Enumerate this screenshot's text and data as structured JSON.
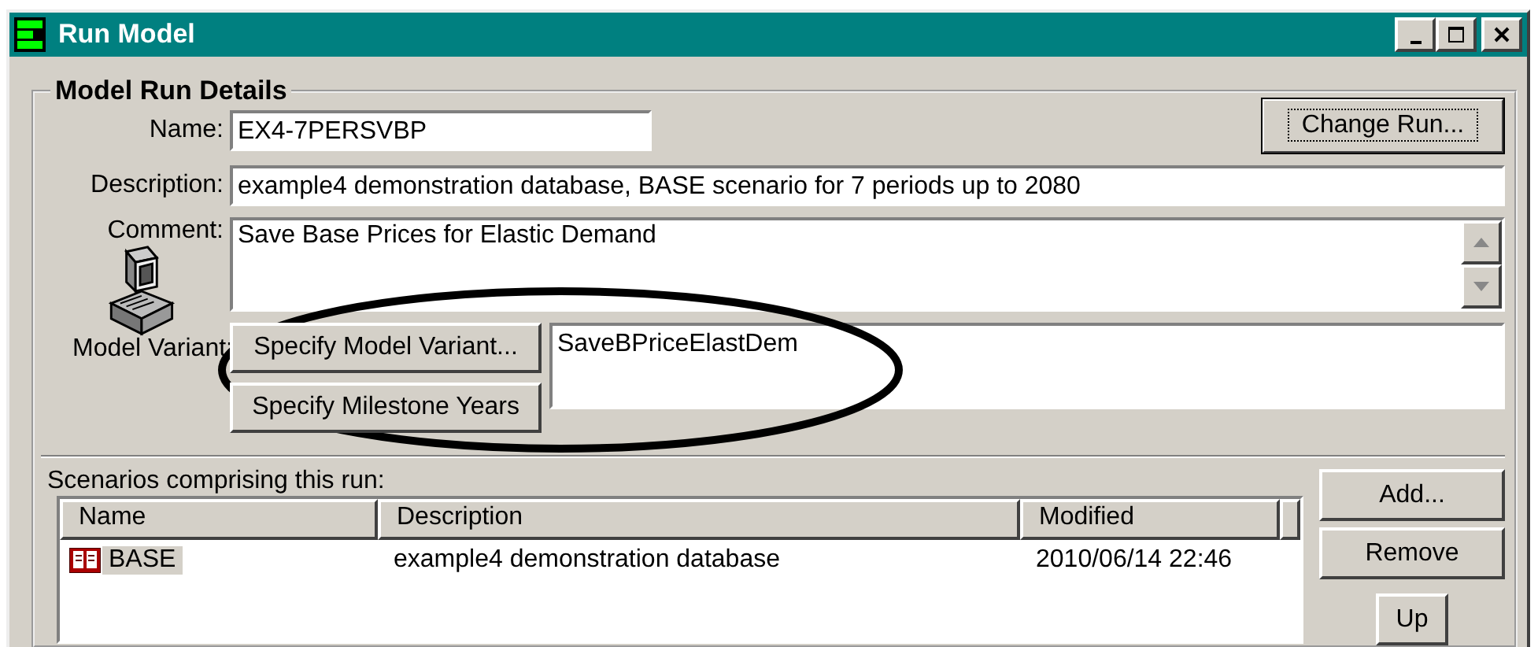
{
  "window": {
    "title": "Run Model"
  },
  "group": {
    "title": "Model Run Details"
  },
  "fields": [
    {
      "kind": "line",
      "label": "Name:",
      "value": "EX4-7PERSVBP"
    },
    {
      "kind": "wide",
      "label": "Description:",
      "value": "example4 demonstration database, BASE scenario for 7 periods up to 2080"
    },
    {
      "kind": "memo",
      "label": "Comment:",
      "value": "Save Base Prices for Elastic Demand"
    },
    {
      "kind": "variant",
      "label": "Model Variant:",
      "value": "SaveBPriceElastDem"
    }
  ],
  "change_run": {
    "label": "Change Run...",
    "default": true
  },
  "variant_buttons": [
    "Specify Model Variant...",
    "Specify Milestone Years"
  ],
  "scenarios": {
    "label": "Scenarios comprising this run:",
    "columns": [
      "Name",
      "Description",
      "Modified"
    ],
    "rows": [
      {
        "name": "BASE",
        "description": "example4 demonstration database",
        "modified": "2010/06/14 22:46",
        "selected": true
      }
    ]
  },
  "side_buttons": [
    "Add...",
    "Remove",
    "Up"
  ]
}
